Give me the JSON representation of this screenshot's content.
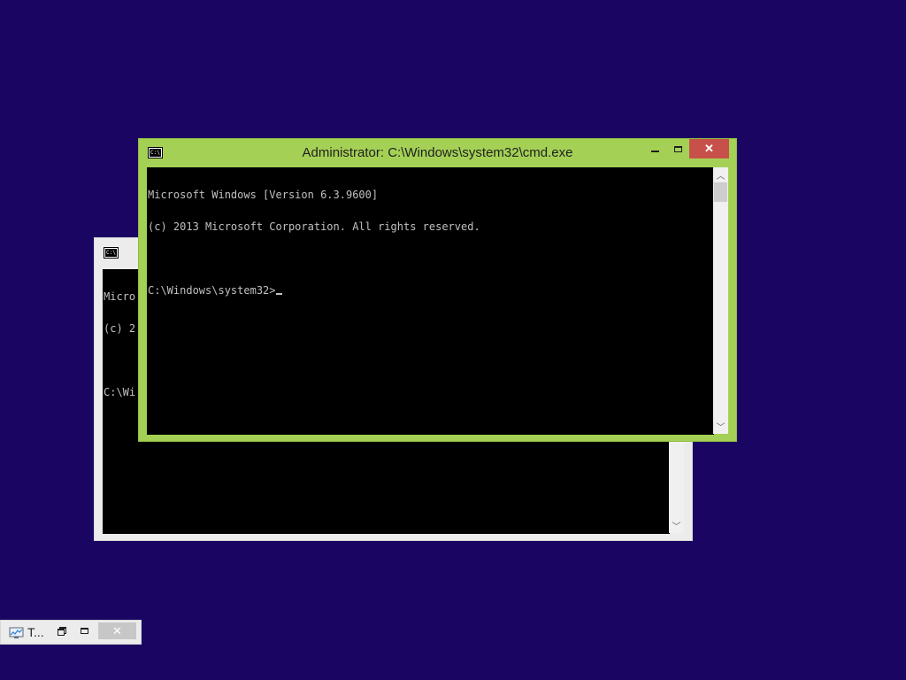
{
  "colors": {
    "desktop": "#1a0563",
    "active_frame": "#a4d155",
    "inactive_frame": "#ececec",
    "close_button": "#c7514a",
    "console_bg": "#000000",
    "console_text": "#c0c0c0"
  },
  "icons": {
    "app": "cmd-icon",
    "minimize": "minimize-icon",
    "maximize": "maximize-icon",
    "close": "close-icon",
    "restore": "restore-icon",
    "scroll_up": "chevron-up-icon",
    "scroll_down": "chevron-down-icon",
    "task_manager": "task-manager-icon"
  },
  "app_icon_label": "C:\\.",
  "caption": {
    "close": "✕"
  },
  "scroll": {
    "up": "︿",
    "down": "﹀"
  },
  "foreground_window": {
    "title": "Administrator: C:\\Windows\\system32\\cmd.exe",
    "lines": [
      "Microsoft Windows [Version 6.3.9600]",
      "(c) 2013 Microsoft Corporation. All rights reserved.",
      "",
      "C:\\Windows\\system32>"
    ]
  },
  "background_window": {
    "lines": [
      "Micro",
      "(c) 2",
      "",
      "C:\\Wi"
    ]
  },
  "minimized_window": {
    "title": "T...",
    "close": "✕"
  }
}
